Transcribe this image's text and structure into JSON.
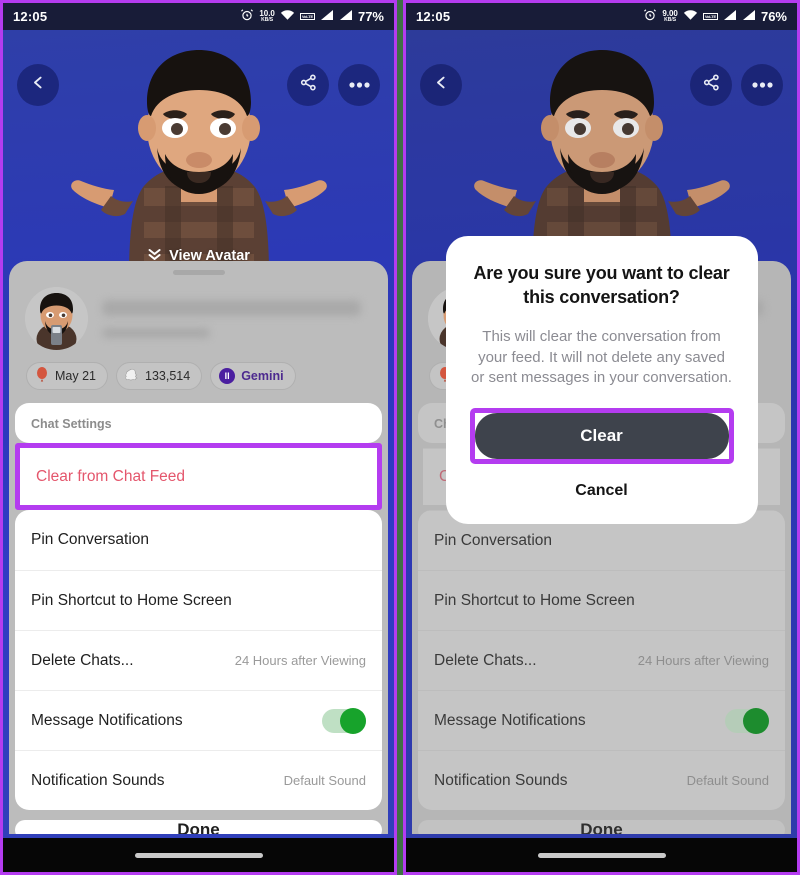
{
  "panels": [
    {
      "id": "left",
      "status_bar": {
        "time": "12:05",
        "alarm_icon": "alarm-clock-icon",
        "net_speed_value": "10.0",
        "net_speed_unit": "KB/S",
        "wifi_icon": "wifi-icon",
        "volte_label": "VoLTE",
        "signal_icon_1": "signal-bars-icon",
        "signal_icon_2": "signal-bars-icon",
        "battery": "77%"
      },
      "topbar": {
        "back_icon": "chevron-left-icon",
        "share_icon": "share-icon",
        "more_icon": "more-horizontal-icon"
      },
      "view_avatar": {
        "label": "View Avatar",
        "icon": "double-chevron-down-icon"
      },
      "profile": {
        "avatar_icon": "bitmoji-avatar",
        "name_redacted": true,
        "username_redacted": true
      },
      "badges": [
        {
          "icon": "balloon-icon",
          "label": "May 21"
        },
        {
          "icon": "snapchat-ghost-icon",
          "label": "133,514"
        },
        {
          "icon": "gemini-zodiac-icon",
          "glyph": "II",
          "label": "Gemini"
        }
      ],
      "settings": {
        "title": "Chat Settings",
        "rows": [
          {
            "label": "Clear from Chat Feed",
            "value": "",
            "style": "danger",
            "highlighted": true
          },
          {
            "label": "Pin Conversation",
            "value": ""
          },
          {
            "label": "Pin Shortcut to Home Screen",
            "value": ""
          },
          {
            "label": "Delete Chats...",
            "value": "24 Hours after Viewing"
          },
          {
            "label": "Message Notifications",
            "value": "",
            "toggle": true,
            "toggle_on": true
          },
          {
            "label": "Notification Sounds",
            "value": "Default Sound"
          }
        ]
      },
      "done_label": "Done",
      "modal": null
    },
    {
      "id": "right",
      "status_bar": {
        "time": "12:05",
        "alarm_icon": "alarm-clock-icon",
        "net_speed_value": "9.00",
        "net_speed_unit": "KB/S",
        "wifi_icon": "wifi-icon",
        "volte_label": "VoLTE",
        "signal_icon_1": "signal-bars-icon",
        "signal_icon_2": "signal-bars-icon",
        "battery": "76%"
      },
      "topbar": {
        "back_icon": "chevron-left-icon",
        "share_icon": "share-icon",
        "more_icon": "more-horizontal-icon"
      },
      "view_avatar": {
        "label": "View Avatar",
        "icon": "double-chevron-down-icon"
      },
      "profile": {
        "avatar_icon": "bitmoji-avatar",
        "name_redacted": true,
        "username_redacted": true
      },
      "badges": [
        {
          "icon": "balloon-icon",
          "label": "May 21"
        },
        {
          "icon": "snapchat-ghost-icon",
          "label": "133,514"
        },
        {
          "icon": "gemini-zodiac-icon",
          "glyph": "II",
          "label": "Gemini"
        }
      ],
      "settings": {
        "title": "Chat Settings",
        "rows": [
          {
            "label": "Clear from Chat Feed",
            "value": "",
            "style": "danger"
          },
          {
            "label": "Pin Conversation",
            "value": ""
          },
          {
            "label": "Pin Shortcut to Home Screen",
            "value": ""
          },
          {
            "label": "Delete Chats...",
            "value": "24 Hours after Viewing"
          },
          {
            "label": "Message Notifications",
            "value": "",
            "toggle": true,
            "toggle_on": true
          },
          {
            "label": "Notification Sounds",
            "value": "Default Sound"
          }
        ]
      },
      "done_label": "Done",
      "modal": {
        "title": "Are you sure you want to clear this conversation?",
        "body": "This will clear the conversation from your feed. It will not delete any saved or sent messages in your conversation.",
        "confirm_label": "Clear",
        "confirm_highlighted": true,
        "cancel_label": "Cancel"
      }
    }
  ],
  "colors": {
    "highlight_purple": "#b43cf0",
    "danger_red": "#e4566c",
    "toggle_green": "#17a32b",
    "confirm_button": "#3e434c",
    "wallpaper_blue": "#2f3bc4",
    "sheet_gray": "#bcbcbc",
    "frame_border": "#b43cf0",
    "page_background": "#3f7046"
  }
}
